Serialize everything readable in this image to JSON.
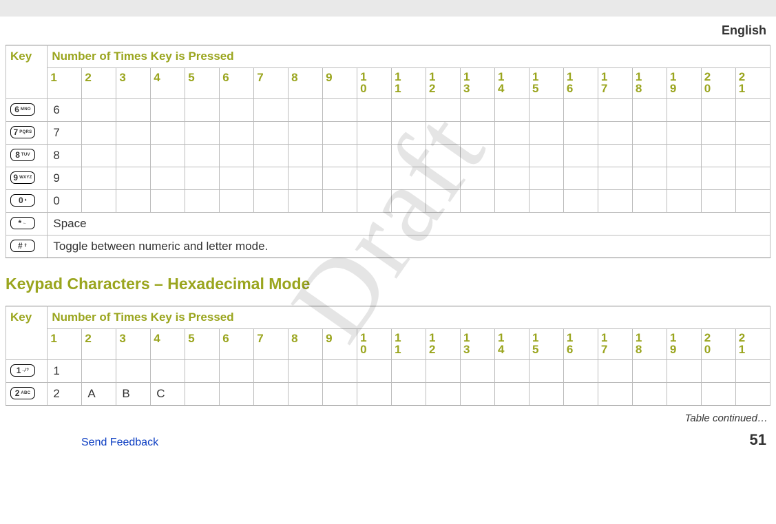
{
  "topbar": {
    "present": true
  },
  "language": "English",
  "watermark": "Draft",
  "table1": {
    "header_key": "Key",
    "header_presses": "Number of Times Key is Pressed",
    "press_cols": [
      "1",
      "2",
      "3",
      "4",
      "5",
      "6",
      "7",
      "8",
      "9",
      "10",
      "11",
      "12",
      "13",
      "14",
      "15",
      "16",
      "17",
      "18",
      "19",
      "20",
      "21"
    ],
    "rows": [
      {
        "key_main": "6",
        "key_sub": "MNO",
        "cells": [
          "6",
          "",
          "",
          "",
          "",
          "",
          "",
          "",
          "",
          "",
          "",
          "",
          "",
          "",
          "",
          "",
          "",
          "",
          "",
          "",
          ""
        ]
      },
      {
        "key_main": "7",
        "key_sub": "PQRS",
        "cells": [
          "7",
          "",
          "",
          "",
          "",
          "",
          "",
          "",
          "",
          "",
          "",
          "",
          "",
          "",
          "",
          "",
          "",
          "",
          "",
          "",
          ""
        ]
      },
      {
        "key_main": "8",
        "key_sub": "TUV",
        "cells": [
          "8",
          "",
          "",
          "",
          "",
          "",
          "",
          "",
          "",
          "",
          "",
          "",
          "",
          "",
          "",
          "",
          "",
          "",
          "",
          "",
          ""
        ]
      },
      {
        "key_main": "9",
        "key_sub": "WXYZ",
        "cells": [
          "9",
          "",
          "",
          "",
          "",
          "",
          "",
          "",
          "",
          "",
          "",
          "",
          "",
          "",
          "",
          "",
          "",
          "",
          "",
          "",
          ""
        ]
      },
      {
        "key_main": "0",
        "key_sub": "♦",
        "cells": [
          "0",
          "",
          "",
          "",
          "",
          "",
          "",
          "",
          "",
          "",
          "",
          "",
          "",
          "",
          "",
          "",
          "",
          "",
          "",
          "",
          ""
        ]
      },
      {
        "key_main": "*",
        "key_sub": "←",
        "cells": [
          "Space",
          "",
          "",
          "",
          "",
          "",
          "",
          "",
          "",
          "",
          "",
          "",
          "",
          "",
          "",
          "",
          "",
          "",
          "",
          "",
          ""
        ],
        "span_all": true
      },
      {
        "key_main": "#",
        "key_sub": "⇧",
        "cells": [
          "Toggle between numeric and letter mode.",
          "",
          "",
          "",
          "",
          "",
          "",
          "",
          "",
          "",
          "",
          "",
          "",
          "",
          "",
          "",
          "",
          "",
          "",
          "",
          ""
        ],
        "span_all": true
      }
    ]
  },
  "section_title": "Keypad Characters – Hexadecimal Mode",
  "table2": {
    "header_key": "Key",
    "header_presses": "Number of Times Key is Pressed",
    "press_cols": [
      "1",
      "2",
      "3",
      "4",
      "5",
      "6",
      "7",
      "8",
      "9",
      "10",
      "11",
      "12",
      "13",
      "14",
      "15",
      "16",
      "17",
      "18",
      "19",
      "20",
      "21"
    ],
    "rows": [
      {
        "key_main": "1",
        "key_sub": ".,/?",
        "cells": [
          "1",
          "",
          "",
          "",
          "",
          "",
          "",
          "",
          "",
          "",
          "",
          "",
          "",
          "",
          "",
          "",
          "",
          "",
          "",
          "",
          ""
        ]
      },
      {
        "key_main": "2",
        "key_sub": "ABC",
        "cells": [
          "2",
          "A",
          "B",
          "C",
          "",
          "",
          "",
          "",
          "",
          "",
          "",
          "",
          "",
          "",
          "",
          "",
          "",
          "",
          "",
          "",
          ""
        ]
      }
    ]
  },
  "continued": "Table continued…",
  "footer": {
    "feedback": "Send Feedback",
    "page": "51"
  }
}
